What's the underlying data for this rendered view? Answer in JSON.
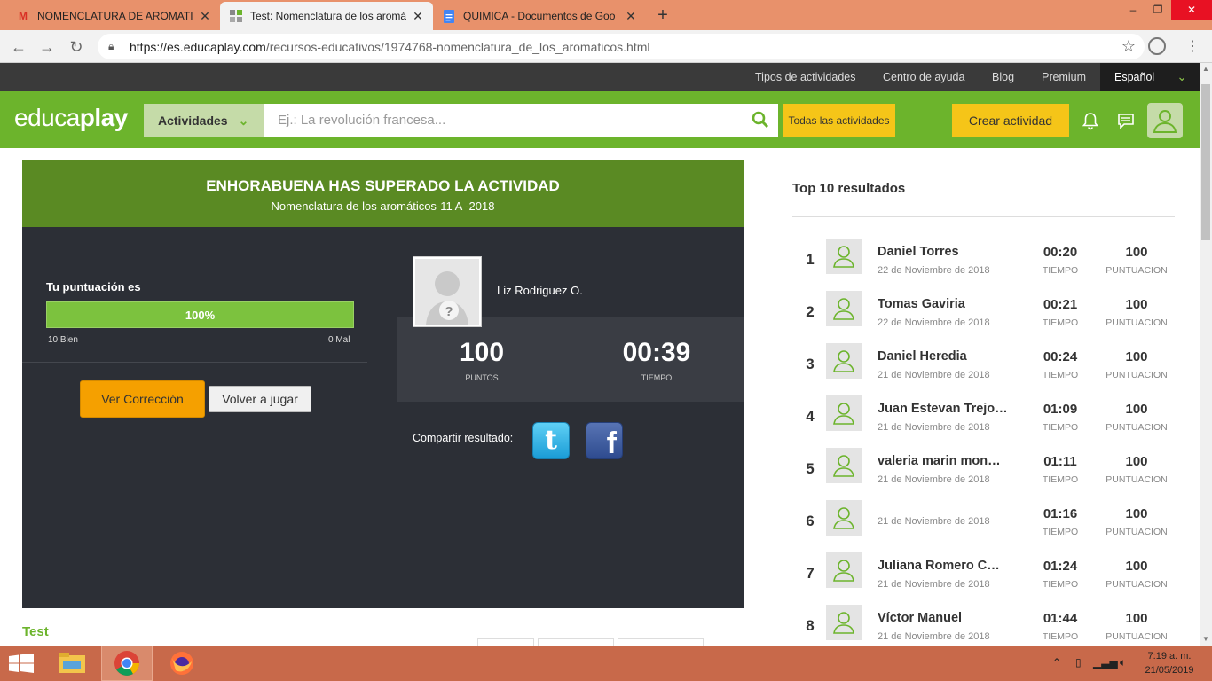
{
  "browser": {
    "tabs": [
      {
        "title": "NOMENCLATURA DE AROMATIC",
        "icon": "gmail-icon"
      },
      {
        "title": "Test: Nomenclatura de los aromá",
        "icon": "educaplay-icon"
      },
      {
        "title": "QUIMICA - Documentos de Goo",
        "icon": "docs-icon"
      }
    ],
    "new_tab": "+",
    "url_host": "https://es.educaplay.com",
    "url_path": "/recursos-educativos/1974768-nomenclatura_de_los_aromaticos.html"
  },
  "site_nav": {
    "links": [
      "Tipos de actividades",
      "Centro de ayuda",
      "Blog",
      "Premium"
    ],
    "language": "Español"
  },
  "header": {
    "logo_light": "educa",
    "logo_bold": "play",
    "activities_label": "Actividades",
    "search_placeholder": "Ej.: La revolución francesa...",
    "all_activities": "Todas las actividades",
    "create_activity": "Crear actividad"
  },
  "result": {
    "title": "ENHORABUENA HAS SUPERADO LA ACTIVIDAD",
    "subtitle": "Nomenclatura de los aromáticos-11 A -2018",
    "score_label": "Tu puntuación es",
    "score_percent": "100%",
    "score_fraction": 1.0,
    "scale_left": "10 Bien",
    "scale_right": "0 Mal",
    "view_correction": "Ver Corrección",
    "play_again": "Volver a jugar",
    "user_name": "Liz Rodriguez O.",
    "points_value": "100",
    "points_label": "PUNTOS",
    "time_value": "00:39",
    "time_label": "TIEMPO",
    "share_label": "Compartir resultado:"
  },
  "section_label": "Test",
  "top10": {
    "title": "Top 10 resultados",
    "time_label": "TIEMPO",
    "score_label": "PUNTUACION",
    "rows": [
      {
        "pos": "1",
        "name": "Daniel Torres",
        "date": "22 de Noviembre de 2018",
        "time": "00:20",
        "score": "100"
      },
      {
        "pos": "2",
        "name": "Tomas Gaviria",
        "date": "22 de Noviembre de 2018",
        "time": "00:21",
        "score": "100"
      },
      {
        "pos": "3",
        "name": "Daniel Heredia",
        "date": "21 de Noviembre de 2018",
        "time": "00:24",
        "score": "100"
      },
      {
        "pos": "4",
        "name": "Juan Estevan Trejo…",
        "date": "21 de Noviembre de 2018",
        "time": "01:09",
        "score": "100"
      },
      {
        "pos": "5",
        "name": "valeria marin mon…",
        "date": "21 de Noviembre de 2018",
        "time": "01:11",
        "score": "100"
      },
      {
        "pos": "6",
        "name": "",
        "date": "21 de Noviembre de 2018",
        "time": "01:16",
        "score": "100"
      },
      {
        "pos": "7",
        "name": "Juliana Romero C…",
        "date": "21 de Noviembre de 2018",
        "time": "01:24",
        "score": "100"
      },
      {
        "pos": "8",
        "name": "Víctor Manuel",
        "date": "21 de Noviembre de 2018",
        "time": "01:44",
        "score": "100"
      }
    ]
  },
  "taskbar": {
    "time": "7:19 a. m.",
    "date": "21/05/2019"
  },
  "colors": {
    "brand_green": "#6cb42c",
    "header_dark_green": "#5a8a23",
    "accent_yellow": "#f5c518",
    "panel_dark": "#2c2f36",
    "button_orange": "#f5a000"
  }
}
